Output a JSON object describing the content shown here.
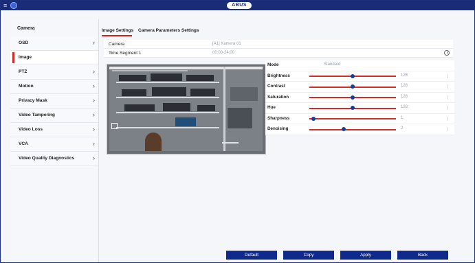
{
  "header": {
    "logo_text": "ABUS",
    "menu_icon": "menu-icon",
    "app_icon": "gear-icon",
    "bar_color": "#1a2c78"
  },
  "sidebar": {
    "title": "Camera",
    "items": [
      {
        "label": "OSD",
        "chevron": true,
        "active": false
      },
      {
        "label": "Image",
        "chevron": false,
        "active": true
      },
      {
        "label": "PTZ",
        "chevron": true,
        "active": false
      },
      {
        "label": "Motion",
        "chevron": true,
        "active": false
      },
      {
        "label": "Privacy Mask",
        "chevron": true,
        "active": false
      },
      {
        "label": "Video Tampering",
        "chevron": true,
        "active": false
      },
      {
        "label": "Video Loss",
        "chevron": true,
        "active": false
      },
      {
        "label": "VCA",
        "chevron": true,
        "active": false
      },
      {
        "label": "Video Quality Diagnostics",
        "chevron": true,
        "active": false
      }
    ],
    "active_marker_color": "#d12a2a"
  },
  "tabs": [
    {
      "label": "Image Settings",
      "active": true
    },
    {
      "label": "Camera Parameters Settings",
      "active": false
    }
  ],
  "camera_row": {
    "label": "Camera",
    "value": "[A1] Kamera 01"
  },
  "time_row": {
    "label": "Time Segment 1",
    "value": "00:00-24:00"
  },
  "settings": {
    "mode": {
      "label": "Mode",
      "value": "Standard"
    },
    "sliders": [
      {
        "label": "Brightness",
        "value": "128",
        "fraction": 0.5
      },
      {
        "label": "Contrast",
        "value": "128",
        "fraction": 0.5
      },
      {
        "label": "Saturation",
        "value": "128",
        "fraction": 0.5
      },
      {
        "label": "Hue",
        "value": "128",
        "fraction": 0.5
      },
      {
        "label": "Sharpness",
        "value": "1",
        "fraction": 0.05
      },
      {
        "label": "Denoising",
        "value": "2",
        "fraction": 0.4
      }
    ],
    "slider_track_color": "#d32a2a",
    "slider_knob_color": "#1a3c96"
  },
  "footer": {
    "default_label": "Default",
    "copy_label": "Copy",
    "apply_label": "Apply",
    "back_label": "Back",
    "button_color": "#0d2a8c"
  }
}
